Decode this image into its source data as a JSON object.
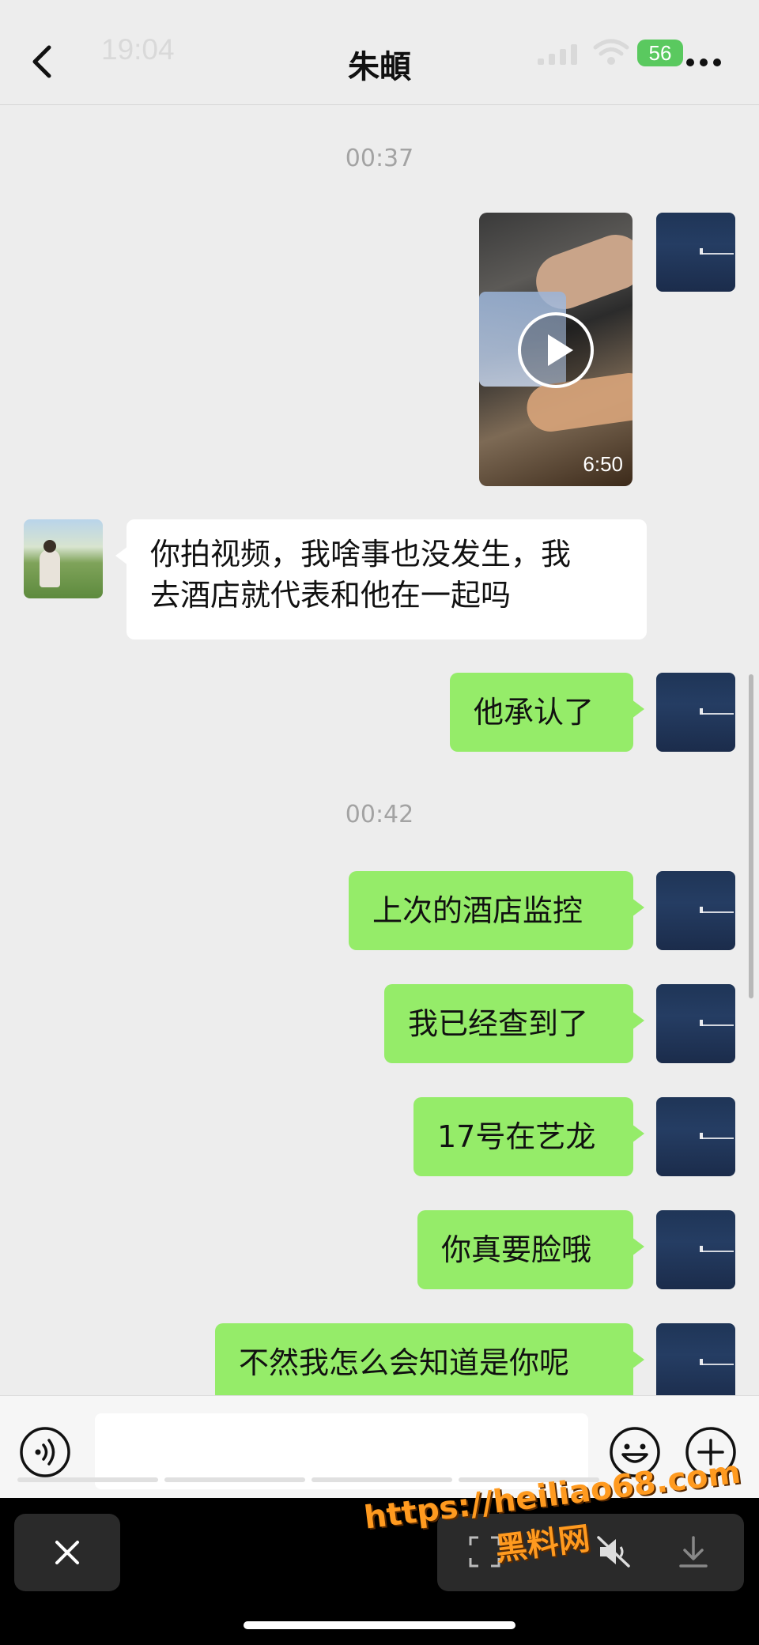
{
  "status_bar": {
    "time": "19:04",
    "battery": "56"
  },
  "header": {
    "title": "朱頔"
  },
  "messages": [
    {
      "type": "timestamp",
      "text": "00:37"
    },
    {
      "type": "video",
      "from": "me",
      "duration": "6:50"
    },
    {
      "type": "text",
      "from": "them",
      "lines": [
        "你拍视频，我啥事也没发生，我",
        "去酒店就代表和他在一起吗"
      ]
    },
    {
      "type": "text",
      "from": "me",
      "text": "他承认了"
    },
    {
      "type": "timestamp",
      "text": "00:42"
    },
    {
      "type": "text",
      "from": "me",
      "text": "上次的酒店监控"
    },
    {
      "type": "text",
      "from": "me",
      "text": "我已经查到了"
    },
    {
      "type": "text",
      "from": "me",
      "text": "17号在艺龙"
    },
    {
      "type": "text",
      "from": "me",
      "text": "你真要脸哦"
    },
    {
      "type": "text",
      "from": "me",
      "text": "不然我怎么会知道是你呢"
    }
  ],
  "input": {
    "placeholder": ""
  },
  "watermark": {
    "url": "https://heiliao68.com",
    "name": "黑料网"
  },
  "colors": {
    "my_bubble": "#95ec69",
    "their_bubble": "#ffffff",
    "background": "#ededed",
    "watermark": "#ff9a1f"
  },
  "icons": [
    "back-icon",
    "signal-icon",
    "wifi-icon",
    "more-icon",
    "play-icon",
    "voice-icon",
    "emoji-icon",
    "plus-icon",
    "close-icon",
    "scan-icon",
    "mute-icon",
    "download-icon"
  ]
}
